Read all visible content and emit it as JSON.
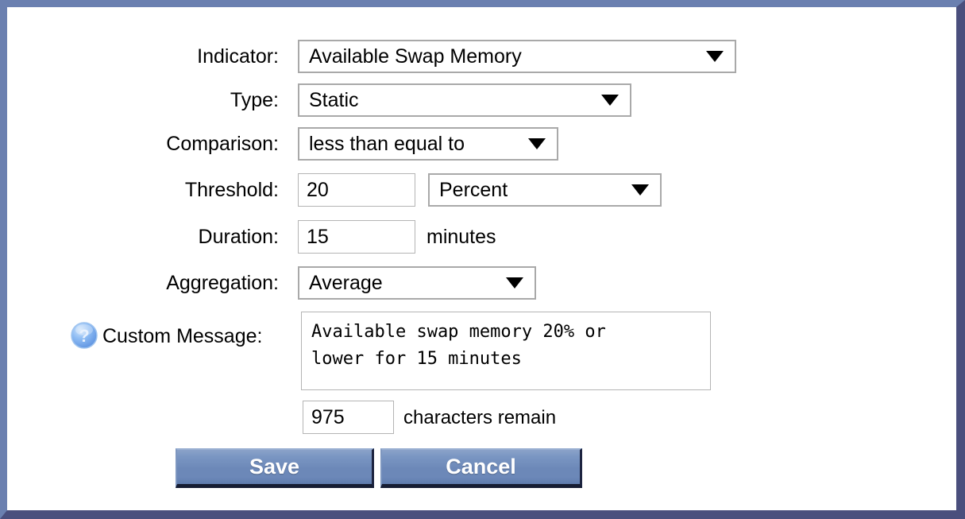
{
  "form": {
    "rows": [
      {
        "label": "Indicator:",
        "control": "select",
        "value": "Available Swap Memory",
        "name": "indicator"
      },
      {
        "label": "Type:",
        "control": "select",
        "value": "Static",
        "name": "type"
      },
      {
        "label": "Comparison:",
        "control": "select",
        "value": "less than equal to",
        "name": "comparison"
      },
      {
        "label": "Threshold:",
        "control": "input-select",
        "value": "20",
        "unit": "Percent",
        "name": "threshold"
      },
      {
        "label": "Duration:",
        "control": "input-text",
        "value": "15",
        "unit": "minutes",
        "name": "duration"
      },
      {
        "label": "Aggregation:",
        "control": "select",
        "value": "Average",
        "name": "aggregation"
      }
    ],
    "custom_message": {
      "label": "Custom Message:",
      "help_icon": "question-mark-help-icon",
      "value": "Available swap memory 20% or\nlower for 15 minutes",
      "chars_remain_count": "975",
      "chars_remain_label": "characters remain"
    }
  },
  "buttons": {
    "save_label": "Save",
    "cancel_label": "Cancel"
  },
  "icons": {
    "dropdown_arrow": "chevron-down-icon"
  },
  "colors": {
    "frame_light": "#6b80b0",
    "frame_dark": "#4a4f7d",
    "button_blue": "#6c88b8",
    "button_shadow": "#161d33",
    "select_border": "#a9a9a9",
    "input_border": "#b4b4b4",
    "help_icon_blue": "#7ab0f0",
    "text": "#000000",
    "background": "#ffffff"
  }
}
